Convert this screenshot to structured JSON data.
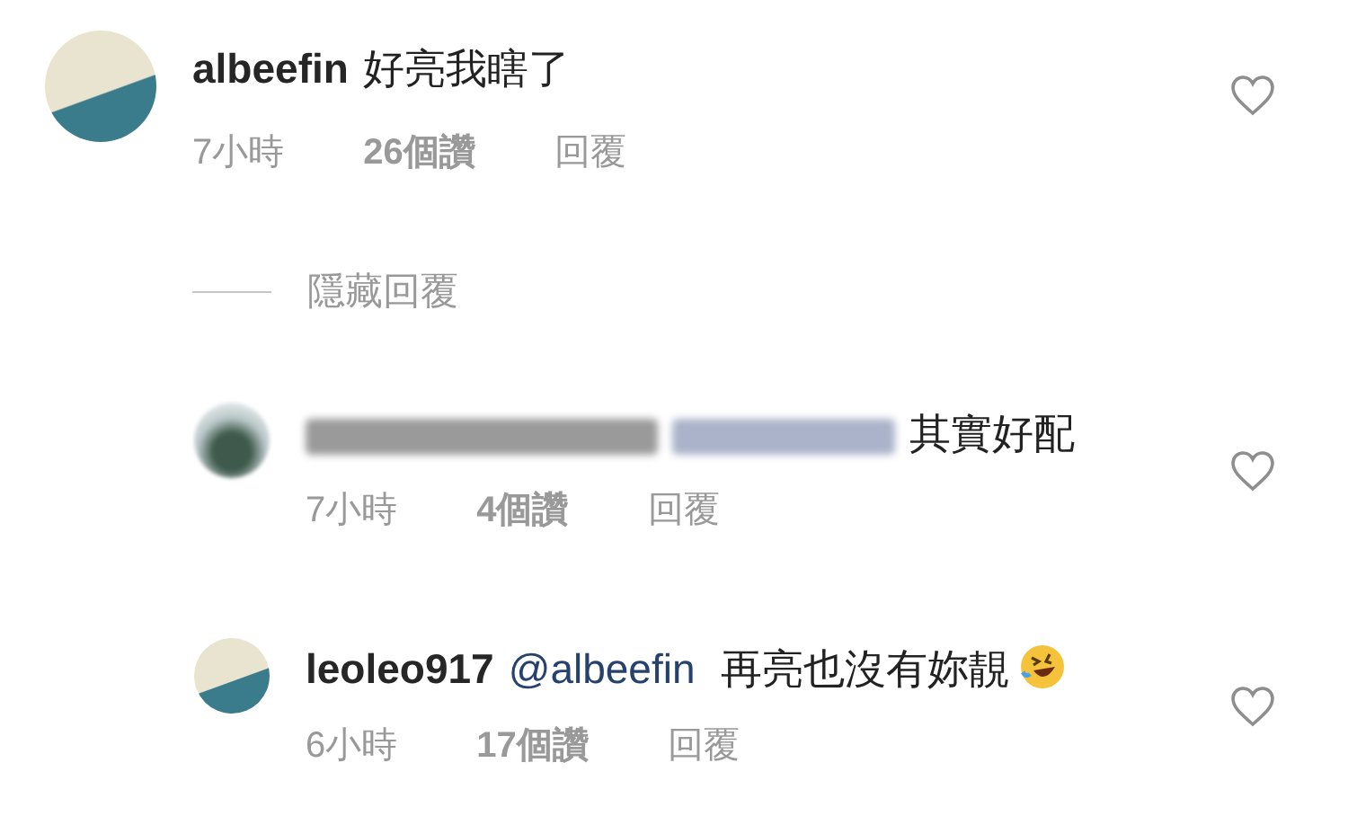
{
  "comments": [
    {
      "kind": "comment",
      "username": "albeefin",
      "text": "好亮我瞎了",
      "time": "7小時",
      "likes": "26個讚",
      "reply": "回覆",
      "liked": false,
      "avatar_blurred": false
    },
    {
      "kind": "toggle",
      "label": "隱藏回覆"
    },
    {
      "kind": "reply",
      "username_blurred": true,
      "mention_blurred": true,
      "text": "其實好配",
      "time": "7小時",
      "likes": "4個讚",
      "reply": "回覆",
      "liked": false,
      "avatar_blurred": true
    },
    {
      "kind": "reply",
      "username": "leoleo917",
      "mention": "@albeefin",
      "text": "再亮也沒有妳靚",
      "emoji": true,
      "time": "6小時",
      "likes": "17個讚",
      "reply": "回覆",
      "liked": false,
      "avatar_blurred": false
    }
  ]
}
